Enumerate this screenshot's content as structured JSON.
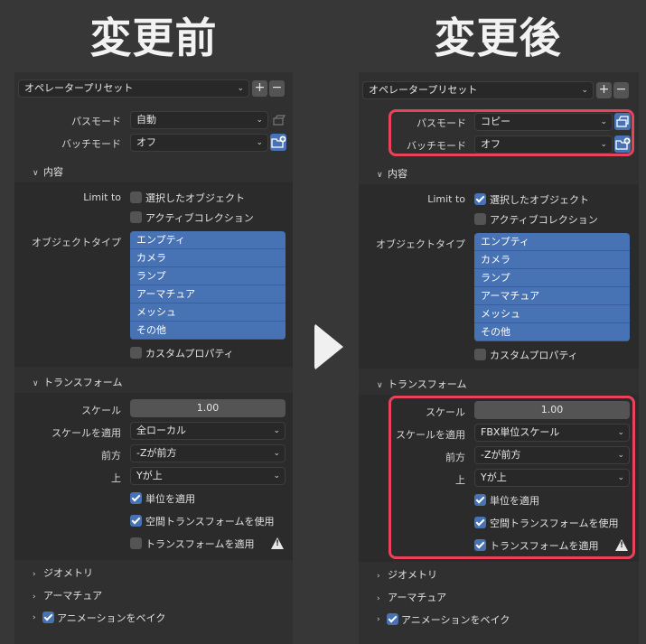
{
  "titles": {
    "before": "変更前",
    "after": "変更後"
  },
  "preset": {
    "label": "オペレータープリセット",
    "add": "+",
    "remove": "−"
  },
  "labels": {
    "path_mode": "パスモード",
    "batch_mode": "バッチモード",
    "content": "内容",
    "limit_to": "Limit to",
    "selected_objects": "選択したオブジェクト",
    "active_collection": "アクティブコレクション",
    "object_types": "オブジェクトタイプ",
    "custom_props": "カスタムプロパティ",
    "transform": "トランスフォーム",
    "scale": "スケール",
    "apply_scale": "スケールを適用",
    "forward": "前方",
    "up": "上",
    "apply_unit": "単位を適用",
    "use_space_transform": "空間トランスフォームを使用",
    "apply_transform": "トランスフォームを適用",
    "geometry": "ジオメトリ",
    "armature": "アーマチュア",
    "bake_animation": "アニメーションをベイク"
  },
  "object_type_items": [
    "エンプティ",
    "カメラ",
    "ランプ",
    "アーマチュア",
    "メッシュ",
    "その他"
  ],
  "before": {
    "path_mode": "自動",
    "batch_mode": "オフ",
    "scale": "1.00",
    "apply_scale": "全ローカル",
    "forward": "-Zが前方",
    "up": "Yが上",
    "selected_objects_checked": false,
    "apply_transform_checked": false
  },
  "after": {
    "path_mode": "コピー",
    "batch_mode": "オフ",
    "scale": "1.00",
    "apply_scale": "FBX単位スケール",
    "forward": "-Zが前方",
    "up": "Yが上",
    "selected_objects_checked": true,
    "apply_transform_checked": true
  },
  "colors": {
    "accent": "#4772b3",
    "highlight": "#e8435a"
  },
  "icons": {
    "chevron": "chevron-down-icon",
    "pack": "pack-icon",
    "folder": "folder-plus-icon",
    "warning": "warning-icon"
  }
}
